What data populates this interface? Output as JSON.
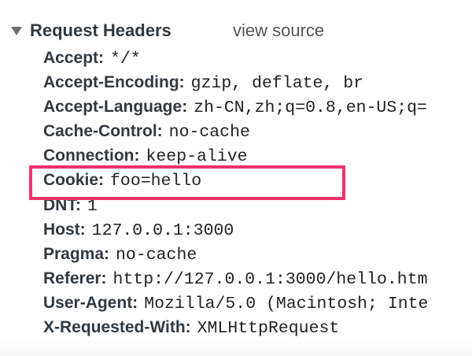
{
  "section": {
    "title": "Request Headers",
    "view_source_label": "view source"
  },
  "headers": [
    {
      "name": "Accept:",
      "value": "*/*"
    },
    {
      "name": "Accept-Encoding:",
      "value": "gzip, deflate, br"
    },
    {
      "name": "Accept-Language:",
      "value": "zh-CN,zh;q=0.8,en-US;q="
    },
    {
      "name": "Cache-Control:",
      "value": "no-cache"
    },
    {
      "name": "Connection:",
      "value": "keep-alive"
    },
    {
      "name": "Cookie:",
      "value": "foo=hello"
    },
    {
      "name": "DNT:",
      "value": "1"
    },
    {
      "name": "Host:",
      "value": "127.0.0.1:3000"
    },
    {
      "name": "Pragma:",
      "value": "no-cache"
    },
    {
      "name": "Referer:",
      "value": "http://127.0.0.1:3000/hello.htm"
    },
    {
      "name": "User-Agent:",
      "value": "Mozilla/5.0 (Macintosh; Inte"
    },
    {
      "name": "X-Requested-With:",
      "value": "XMLHttpRequest"
    }
  ],
  "highlight": {
    "color": "#f2326e",
    "target": "Cookie"
  }
}
